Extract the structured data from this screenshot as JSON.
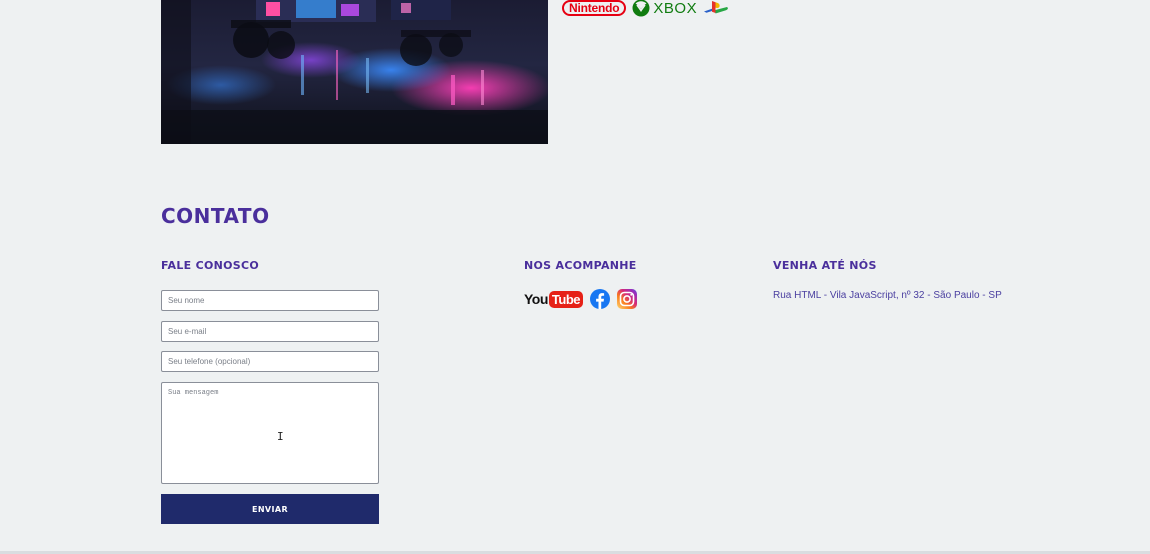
{
  "brands": {
    "nintendo": "Nintendo",
    "xbox": "XBOX"
  },
  "contact": {
    "title": "Contato",
    "talk_to_us": {
      "title": "Fale conosco",
      "name_placeholder": "Seu nome",
      "email_placeholder": "Seu e-mail",
      "phone_placeholder": "Seu telefone (opcional)",
      "message_placeholder": "Sua mensagem",
      "submit_label": "Enviar"
    },
    "follow_us": {
      "title": "Nos acompanhe",
      "icons": [
        "youtube-icon",
        "facebook-icon",
        "instagram-icon"
      ],
      "youtube_you": "You",
      "youtube_tube": "Tube"
    },
    "visit_us": {
      "title": "Venha até nós",
      "address": "Rua HTML - Vila JavaScript, nº 32 - São Paulo - SP"
    }
  },
  "colors": {
    "background": "#eef1f2",
    "heading": "#4a2f9c",
    "button": "#1f2a6b",
    "nintendo_red": "#e60012",
    "xbox_green": "#107c10",
    "youtube_red": "#e62117",
    "facebook_blue": "#1877f2"
  }
}
